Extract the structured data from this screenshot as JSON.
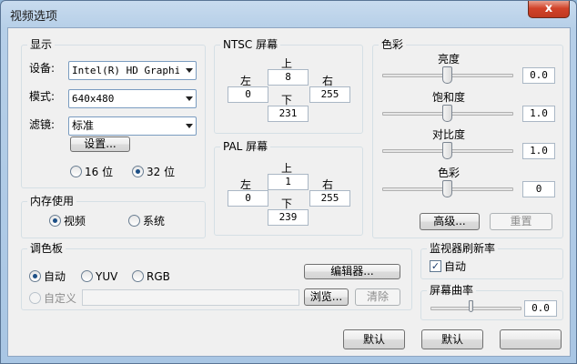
{
  "window": {
    "title": "视频选项",
    "close_glyph": "x"
  },
  "display": {
    "title": "显示",
    "device_label": "设备:",
    "device_value": "Intel(R) HD Graphics",
    "mode_label": "模式:",
    "mode_value": "640x480",
    "filter_label": "滤镜:",
    "filter_value": "标准",
    "settings_button": "设置...",
    "depth_16": "16 位",
    "depth_32": "32 位",
    "selected_depth": "32 位"
  },
  "memory": {
    "title": "内存使用",
    "video": "视频",
    "system": "系统",
    "selected": "视频"
  },
  "ntsc": {
    "title": "NTSC 屏幕",
    "top_label": "上",
    "top_value": "8",
    "left_label": "左",
    "left_value": "0",
    "right_label": "右",
    "right_value": "255",
    "bottom_label": "下",
    "bottom_value": "231"
  },
  "pal": {
    "title": "PAL 屏幕",
    "top_label": "上",
    "top_value": "1",
    "left_label": "左",
    "left_value": "0",
    "right_label": "右",
    "right_value": "255",
    "bottom_label": "下",
    "bottom_value": "239"
  },
  "color": {
    "title": "色彩",
    "brightness_label": "亮度",
    "brightness_value": "0.0",
    "saturation_label": "饱和度",
    "saturation_value": "1.0",
    "contrast_label": "对比度",
    "contrast_value": "1.0",
    "hue_label": "色彩",
    "hue_value": "0",
    "advanced_button": "高级...",
    "reset_button": "重置"
  },
  "palette": {
    "title": "调色板",
    "auto": "自动",
    "yuv": "YUV",
    "rgb": "RGB",
    "custom": "自定义",
    "selected": "自动",
    "editor_button": "编辑器...",
    "browse_button": "浏览...",
    "clear_button": "清除"
  },
  "refresh": {
    "title": "监视器刷新率",
    "auto_label": "自动",
    "auto_checked": true
  },
  "curvature": {
    "title": "屏幕曲率",
    "value": "0.0"
  },
  "footer": {
    "default_button_1": "默认",
    "default_button_2": "默认"
  },
  "icons": {
    "check": "✓"
  }
}
